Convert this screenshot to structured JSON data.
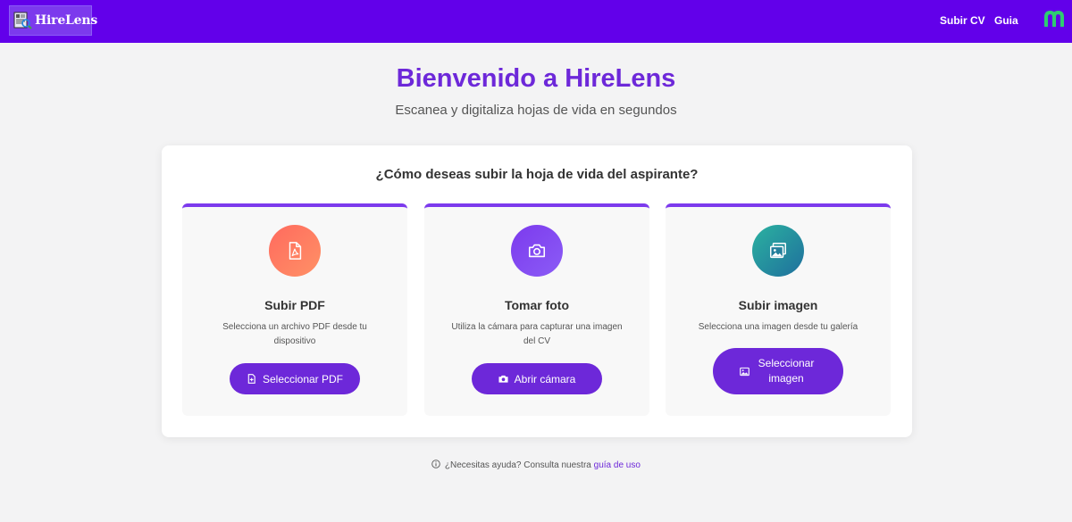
{
  "header": {
    "logo_text": "HireLens",
    "nav": {
      "upload_cv": "Subir CV",
      "guide": "Guia"
    },
    "bar_color": "#6200ea",
    "brand_icon": "m-brand-icon"
  },
  "hero": {
    "title": "Bienvenido a HireLens",
    "subtitle": "Escanea y digitaliza hojas de vida en segundos"
  },
  "panel": {
    "question": "¿Cómo deseas subir la hoja de vida del aspirante?",
    "options": [
      {
        "icon": "pdf-file-icon",
        "title": "Subir PDF",
        "description": "Selecciona un archivo PDF desde tu dispositivo",
        "button_icon": "file-plus-icon",
        "button_label": "Seleccionar PDF"
      },
      {
        "icon": "camera-icon",
        "title": "Tomar foto",
        "description": "Utiliza la cámara para capturar una imagen del CV",
        "button_icon": "camera-icon",
        "button_label": "Abrir cámara"
      },
      {
        "icon": "images-icon",
        "title": "Subir imagen",
        "description": "Selecciona una imagen desde tu galería",
        "button_icon": "image-icon",
        "button_label": "Seleccionar imagen"
      }
    ]
  },
  "help": {
    "icon": "info-icon",
    "prefix": "¿Necesitas ayuda?",
    "text": "Consulta nuestra",
    "link": "guía de uso"
  },
  "colors": {
    "accent": "#6d28d9",
    "pdf_gradient": [
      "#ff6a5e",
      "#ff9166"
    ],
    "camera_gradient": [
      "#7c3aed",
      "#8b5cf6"
    ],
    "image_gradient": [
      "#2bb2a0",
      "#1f6f9d"
    ],
    "brand_m": "#2ecc71"
  }
}
